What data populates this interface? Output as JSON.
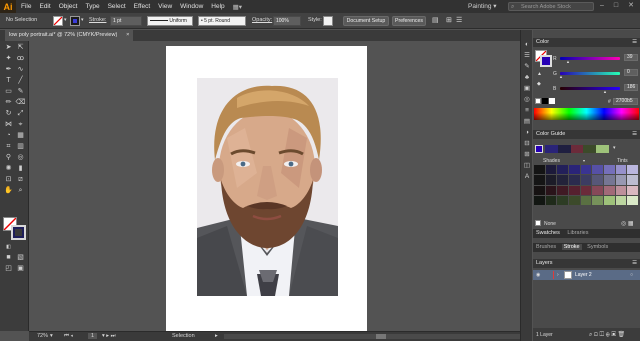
{
  "app": {
    "logo": "Ai",
    "workspace": "Painting",
    "search_placeholder": "Search Adobe Stock"
  },
  "menu": [
    "File",
    "Edit",
    "Object",
    "Type",
    "Select",
    "Effect",
    "View",
    "Window",
    "Help"
  ],
  "control_bar": {
    "selection": "No Selection",
    "stroke_label": "Stroke:",
    "stroke_weight": "1 pt",
    "profile": "Uniform",
    "brush": "5 pt. Round",
    "opacity_label": "Opacity:",
    "opacity_value": "100%",
    "style_label": "Style:",
    "doc_setup": "Document Setup",
    "preferences": "Preferences"
  },
  "document": {
    "tab_title": "low poly portrait.ai* @ 72% (CMYK/Preview)",
    "close": "×"
  },
  "status": {
    "zoom": "72%",
    "page": "1",
    "tool": "Selection"
  },
  "color_panel": {
    "title": "Color",
    "channels": [
      {
        "name": "R",
        "value": "39"
      },
      {
        "name": "G",
        "value": "0"
      },
      {
        "name": "B",
        "value": "186"
      }
    ],
    "hex_prefix": "#",
    "hex": "2700b5",
    "accent": "#2700b5"
  },
  "color_guide": {
    "title": "Color Guide",
    "shades": "Shades",
    "tints": "Tints",
    "none": "None"
  },
  "swatch_tabs": {
    "swatches": "Swatches",
    "libraries": "Libraries"
  },
  "brush_tabs": {
    "brushes": "Brushes",
    "stroke": "Stroke",
    "symbols": "Symbols"
  },
  "layers": {
    "title": "Layers",
    "layer_name": "Layer 2",
    "count": "1 Layer"
  }
}
